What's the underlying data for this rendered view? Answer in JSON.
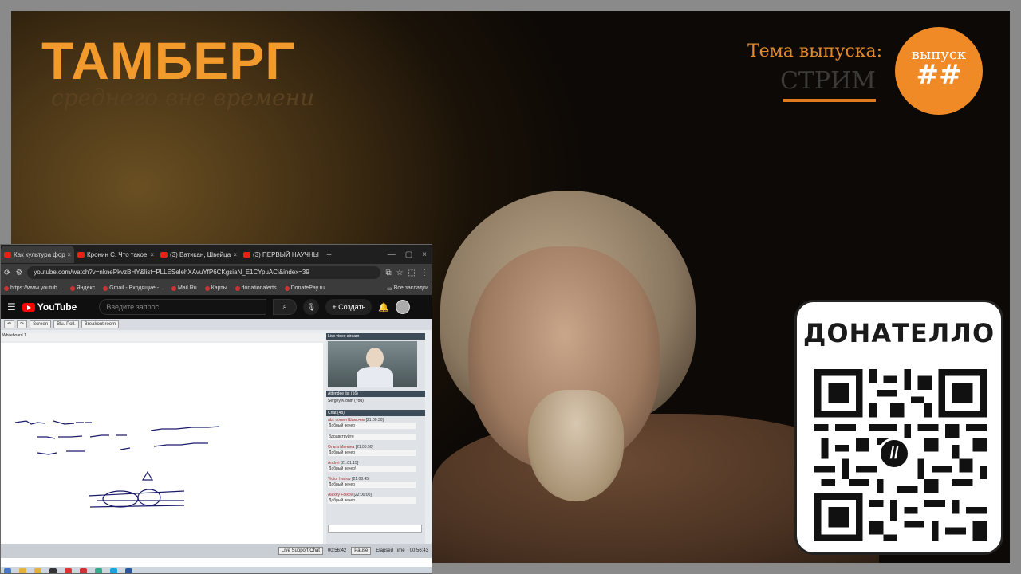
{
  "brand": {
    "title": "ТАМБЕРГ",
    "subtitle": "среднего вне времени"
  },
  "topic": {
    "label": "Тема выпуска:",
    "value": "СТРИМ"
  },
  "episode": {
    "label": "выпуск",
    "number": "##"
  },
  "donation": {
    "title": "ДОНАТЕЛЛО",
    "logo_glyph": "//"
  },
  "colors": {
    "accent": "#f08a26",
    "brand": "#f39a2c"
  },
  "browser": {
    "tabs": [
      {
        "label": "Как культура форм...",
        "active": true
      },
      {
        "label": "Кронин С. Что такое",
        "active": false
      },
      {
        "label": "(3) Ватикан, Швейца",
        "active": false
      },
      {
        "label": "(3) ПЕРВЫЙ НАУЧНЫ",
        "active": false
      }
    ],
    "url": "youtube.com/watch?v=nknePkvzBHY&list=PLLESelehXAvuYfP6CKgsiaN_E1CYpuACi&index=39",
    "bookmarks": [
      "https://www.youtub...",
      "Яндекс",
      "Gmail - Входящие -...",
      "Mail.Ru",
      "Карты",
      "donationalerts",
      "DonatePay.ru"
    ],
    "bookmarks_all": "Все закладки"
  },
  "youtube": {
    "logo": "YouTube",
    "search_placeholder": "Введите запрос",
    "create_label": "Создать"
  },
  "app": {
    "toolbar": [
      "Screen",
      "Blu. Poll.",
      "Breakout room"
    ],
    "whiteboard_tab": "Whiteboard 1",
    "video_header": "Live video stream",
    "attendee_header": "Attendee list (16)",
    "attendee_user": "Sergey Kronin (You)",
    "chat_header": "Chat (48)",
    "messages": [
      {
        "name": "abz сомин Шамрчик",
        "time": "[21:00:30]",
        "text": "Добрый вечер"
      },
      {
        "name": "",
        "time": "",
        "text": "Здравствуйте"
      },
      {
        "name": "Ольга Минина",
        "time": "[21:00:50]",
        "text": "Добрый вечер"
      },
      {
        "name": "Andrei",
        "time": "[21:01:15]",
        "text": "Добрый вечер!"
      },
      {
        "name": "Victor Ivanov",
        "time": "[21:08:45]",
        "text": "Добрый вечер"
      },
      {
        "name": "Alexey Folkov",
        "time": "[22:00:00]",
        "text": "Добрый вечер."
      }
    ],
    "status": {
      "support": "Live Support Chat",
      "time1": "00:56:42",
      "pause": "Pause",
      "elapsed_label": "Elapsed Time",
      "elapsed": "00:56:43"
    }
  }
}
